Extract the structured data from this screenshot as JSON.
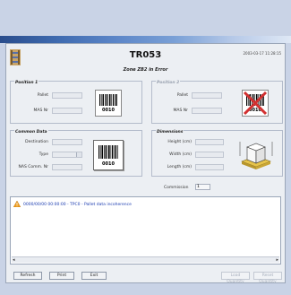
{
  "window": {
    "title": "TR053",
    "timestamp": "2003-03-17 11:28:15",
    "subtitle": "Zone ZB2 in Error"
  },
  "position1": {
    "label": "Position 1",
    "pallet_label": "Pallet",
    "mas_label": "MAS Nr",
    "barcode": "0010"
  },
  "position2": {
    "label": "Position 2",
    "pallet_label": "Pallet",
    "mas_label": "MAS Nr",
    "barcode": "0010"
  },
  "common_data": {
    "label": "Common Data",
    "destination_label": "Destination",
    "type_label": "Type",
    "nas_label": "NAS Comm. Nr",
    "barcode": "0010"
  },
  "dimensions": {
    "label": "Dimensions",
    "height_label": "Height (cm)",
    "width_label": "Width (cm)",
    "length_label": "Length (cm)"
  },
  "commission": {
    "label": "Commission",
    "value": "1"
  },
  "messages": [
    {
      "text": "0000/00/00 00:00:00 - TPC0 - Pallet data incoherence"
    }
  ],
  "buttons": {
    "refresh": "Refresh",
    "print": "Print",
    "exit": "Exit",
    "right1": "Load Quantity",
    "right2": "Reset Quantity"
  },
  "scroll": {
    "left_arrow": "◂",
    "right_arrow": "▸"
  },
  "colors": {
    "accent": "#2a4d8c",
    "message_text": "#1a3bb0",
    "error_cross": "#d23030"
  }
}
